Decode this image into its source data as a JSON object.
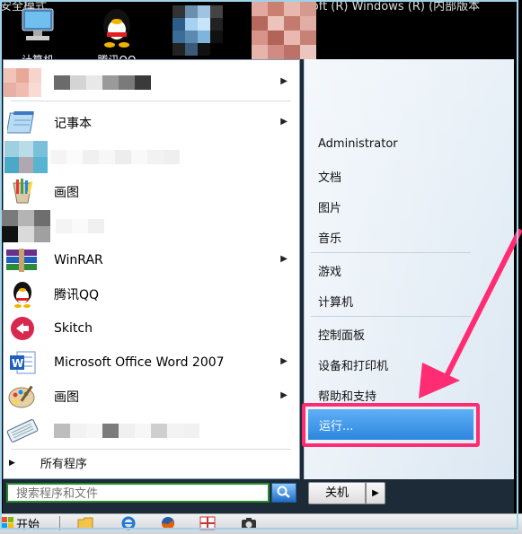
{
  "desktop": {
    "title_left": "安全模式",
    "title_right": "Microsoft (R) Windows (R) (内部版本",
    "icons": [
      {
        "label": "计算机",
        "icon": "computer-icon"
      },
      {
        "label": "腾讯QQ",
        "icon": "qq-penguin-icon"
      }
    ]
  },
  "start_menu": {
    "programs": [
      {
        "label": "",
        "icon": "pixelated-icon",
        "has_arrow": true
      },
      {
        "label": "记事本",
        "icon": "notepad-icon",
        "has_arrow": true
      },
      {
        "label": "",
        "icon": "pixelated-icon",
        "has_arrow": false
      },
      {
        "label": "画图",
        "icon": "paint-icon",
        "has_arrow": false
      },
      {
        "label": "",
        "icon": "pixelated-icon",
        "has_arrow": false
      },
      {
        "label": "WinRAR",
        "icon": "winrar-icon",
        "has_arrow": true
      },
      {
        "label": "腾讯QQ",
        "icon": "qq-penguin-icon",
        "has_arrow": false
      },
      {
        "label": "Skitch",
        "icon": "skitch-icon",
        "has_arrow": false
      },
      {
        "label": "Microsoft Office Word 2007",
        "icon": "word-icon",
        "has_arrow": true
      },
      {
        "label": "画图",
        "icon": "paint-palette-icon",
        "has_arrow": true
      },
      {
        "label": "",
        "icon": "keyboard-icon",
        "has_arrow": false
      }
    ],
    "all_programs": "所有程序",
    "search_placeholder": "搜索程序和文件",
    "right_items": [
      {
        "label": "Administrator"
      },
      {
        "label": "文档"
      },
      {
        "label": "图片"
      },
      {
        "label": "音乐"
      },
      {
        "label": "游戏"
      },
      {
        "label": "计算机"
      },
      {
        "label": "控制面板"
      },
      {
        "label": "设备和打印机"
      },
      {
        "label": "帮助和支持"
      }
    ],
    "run_label": "运行...",
    "shutdown_label": "关机"
  },
  "taskbar": {
    "start_label": "开始",
    "icons": [
      "folder-icon",
      "ie-icon",
      "firefox-icon",
      "media-icon",
      "camera-icon"
    ]
  },
  "colors": {
    "highlight_border": "#ff2c73",
    "run_highlight": "#2d86df",
    "annotation_arrow": "#ff2c73"
  }
}
